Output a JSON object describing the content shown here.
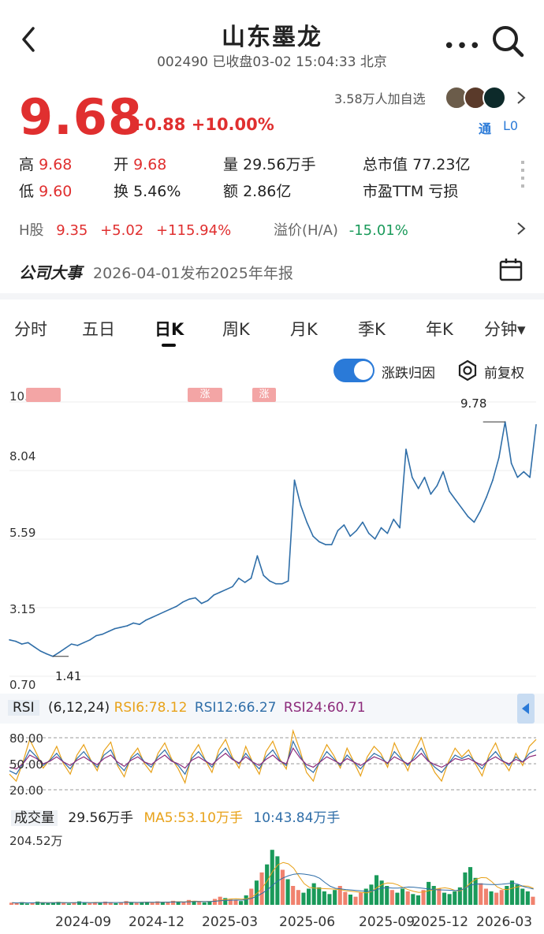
{
  "header": {
    "title": "山东墨龙",
    "subtitle": "002490 已收盘03-02 15:04:33 北京"
  },
  "quote": {
    "price": "9.68",
    "change": "+0.88",
    "change_pct": "+10.00%",
    "watchers": "3.58万人加自选",
    "badge_tong": "通",
    "badge_level": "L0"
  },
  "stats": {
    "high_label": "高",
    "high": "9.68",
    "open_label": "开",
    "open": "9.68",
    "volume_label": "量",
    "volume": "29.56万手",
    "mcap_label": "总市值",
    "mcap": "77.23亿",
    "low_label": "低",
    "low": "9.60",
    "turnover_label": "换",
    "turnover": "5.46%",
    "amount_label": "额",
    "amount": "2.86亿",
    "pe_label": "市盈TTM",
    "pe": "亏损"
  },
  "hshare": {
    "label": "H股",
    "price": "9.35",
    "change": "+5.02",
    "change_pct": "+115.94%",
    "premium_label": "溢价(H/A)",
    "premium": "-15.01%"
  },
  "event": {
    "label": "公司大事",
    "text": "2026-04-01发布2025年年报"
  },
  "tabs": [
    "分时",
    "五日",
    "日K",
    "周K",
    "月K",
    "季K",
    "年K",
    "分钟▾"
  ],
  "chart_controls": {
    "toggle_label": "涨跌归因",
    "adjust_label": "前复权"
  },
  "colors": {
    "up": "#e02f2f",
    "down": "#1a9a5a",
    "price_line": "#2f6ea8",
    "rsi6": "#e8a21a",
    "rsi12": "#2f6ea8",
    "rsi24": "#8c2a7a",
    "accent": "#2a7ad8"
  },
  "rsi": {
    "label": "RSI",
    "params": "(6,12,24)",
    "rsi6": "RSI6:78.12",
    "rsi12": "RSI12:66.27",
    "rsi24": "RSI24:60.71"
  },
  "volume": {
    "label": "成交量",
    "value": "29.56万手",
    "ma5": "MA5:53.10万手",
    "ma10": "10:43.84万手",
    "max": "204.52万"
  },
  "chart_data": [
    {
      "type": "line",
      "title": "日K",
      "y_ticks": [
        "10.49",
        "8.04",
        "5.59",
        "3.15",
        "0.70"
      ],
      "ylim": [
        0.7,
        10.49
      ],
      "x_ticks": [
        "2024-09",
        "2024-12",
        "2025-03",
        "2025-06",
        "2025-09",
        "2025-12",
        "2026-03"
      ],
      "annotations": {
        "high": "9.78",
        "low": "1.41",
        "markers": [
          "涨",
          "涨"
        ]
      },
      "series": [
        {
          "values": [
            2.0,
            1.95,
            1.85,
            1.9,
            1.75,
            1.6,
            1.5,
            1.41,
            1.55,
            1.7,
            1.85,
            1.8,
            1.9,
            2.0,
            2.15,
            2.2,
            2.3,
            2.4,
            2.45,
            2.5,
            2.6,
            2.55,
            2.7,
            2.8,
            2.9,
            3.0,
            3.1,
            3.2,
            3.35,
            3.45,
            3.5,
            3.3,
            3.4,
            3.6,
            3.7,
            3.8,
            3.9,
            4.2,
            4.05,
            4.2,
            5.0,
            4.3,
            4.1,
            4.0,
            4.0,
            4.1,
            7.7,
            6.8,
            6.2,
            5.7,
            5.5,
            5.4,
            5.4,
            5.9,
            6.1,
            5.7,
            5.9,
            6.2,
            5.8,
            5.6,
            6.0,
            5.8,
            6.3,
            6.0,
            8.8,
            7.8,
            7.4,
            7.8,
            7.2,
            7.5,
            8.0,
            7.3,
            7.0,
            6.7,
            6.4,
            6.2,
            6.6,
            7.1,
            7.7,
            8.5,
            9.78,
            8.3,
            7.8,
            8.0,
            7.8,
            9.68
          ]
        }
      ]
    },
    {
      "type": "line",
      "title": "RSI",
      "y_ticks": [
        "80.00",
        "50.00",
        "20.00"
      ],
      "ylim": [
        20,
        80
      ],
      "series": [
        {
          "name": "RSI6",
          "values": [
            38,
            30,
            52,
            78,
            62,
            45,
            55,
            70,
            50,
            38,
            60,
            72,
            55,
            42,
            65,
            75,
            48,
            35,
            58,
            68,
            50,
            40,
            62,
            74,
            56,
            44,
            28,
            60,
            72,
            54,
            40,
            66,
            78,
            58,
            45,
            70,
            52,
            38,
            64,
            76,
            56,
            44,
            88,
            66,
            40,
            30,
            55,
            72,
            60,
            45,
            68,
            52,
            36,
            58,
            70,
            62,
            46,
            74,
            58,
            42,
            64,
            80,
            56,
            40,
            30,
            52,
            68,
            58,
            66,
            50,
            36,
            60,
            74,
            54,
            42,
            62,
            48,
            70,
            78
          ]
        },
        {
          "name": "RSI12",
          "values": [
            42,
            38,
            50,
            66,
            58,
            48,
            54,
            62,
            52,
            44,
            56,
            64,
            54,
            46,
            60,
            66,
            50,
            42,
            56,
            62,
            52,
            46,
            58,
            66,
            54,
            48,
            38,
            56,
            64,
            54,
            46,
            60,
            68,
            56,
            50,
            62,
            52,
            44,
            58,
            66,
            54,
            48,
            76,
            60,
            46,
            40,
            52,
            64,
            56,
            48,
            60,
            52,
            44,
            54,
            62,
            58,
            50,
            64,
            56,
            48,
            58,
            68,
            54,
            46,
            40,
            50,
            60,
            56,
            60,
            52,
            44,
            56,
            64,
            54,
            48,
            58,
            52,
            62,
            66
          ]
        },
        {
          "name": "RSI24",
          "values": [
            46,
            44,
            50,
            60,
            56,
            50,
            53,
            58,
            52,
            48,
            54,
            58,
            53,
            49,
            56,
            60,
            52,
            47,
            54,
            58,
            52,
            49,
            55,
            60,
            53,
            50,
            45,
            54,
            58,
            53,
            49,
            56,
            62,
            55,
            51,
            58,
            52,
            48,
            55,
            60,
            53,
            50,
            68,
            57,
            49,
            46,
            52,
            58,
            54,
            50,
            56,
            52,
            48,
            53,
            58,
            55,
            51,
            58,
            54,
            50,
            55,
            62,
            53,
            49,
            46,
            50,
            56,
            54,
            56,
            52,
            48,
            54,
            58,
            53,
            50,
            55,
            52,
            58,
            60
          ]
        }
      ]
    },
    {
      "type": "bar",
      "title": "成交量",
      "ylim": [
        0,
        204.52
      ],
      "values": [
        8,
        6,
        10,
        5,
        7,
        12,
        9,
        6,
        8,
        11,
        7,
        5,
        9,
        13,
        8,
        6,
        10,
        7,
        12,
        9,
        6,
        8,
        14,
        10,
        7,
        9,
        11,
        8,
        13,
        10,
        9,
        15,
        12,
        10,
        18,
        14,
        11,
        9,
        13,
        22,
        30,
        25,
        20,
        16,
        14,
        35,
        60,
        90,
        120,
        150,
        204,
        180,
        130,
        95,
        70,
        55,
        45,
        60,
        80,
        65,
        50,
        40,
        55,
        70,
        48,
        38,
        30,
        45,
        60,
        75,
        110,
        90,
        70,
        55,
        45,
        60,
        50,
        40,
        35,
        55,
        85,
        70,
        60,
        45,
        40,
        50,
        65,
        120,
        140,
        100,
        80,
        60,
        50,
        45,
        55,
        70,
        90,
        75,
        60,
        50,
        30
      ]
    }
  ]
}
